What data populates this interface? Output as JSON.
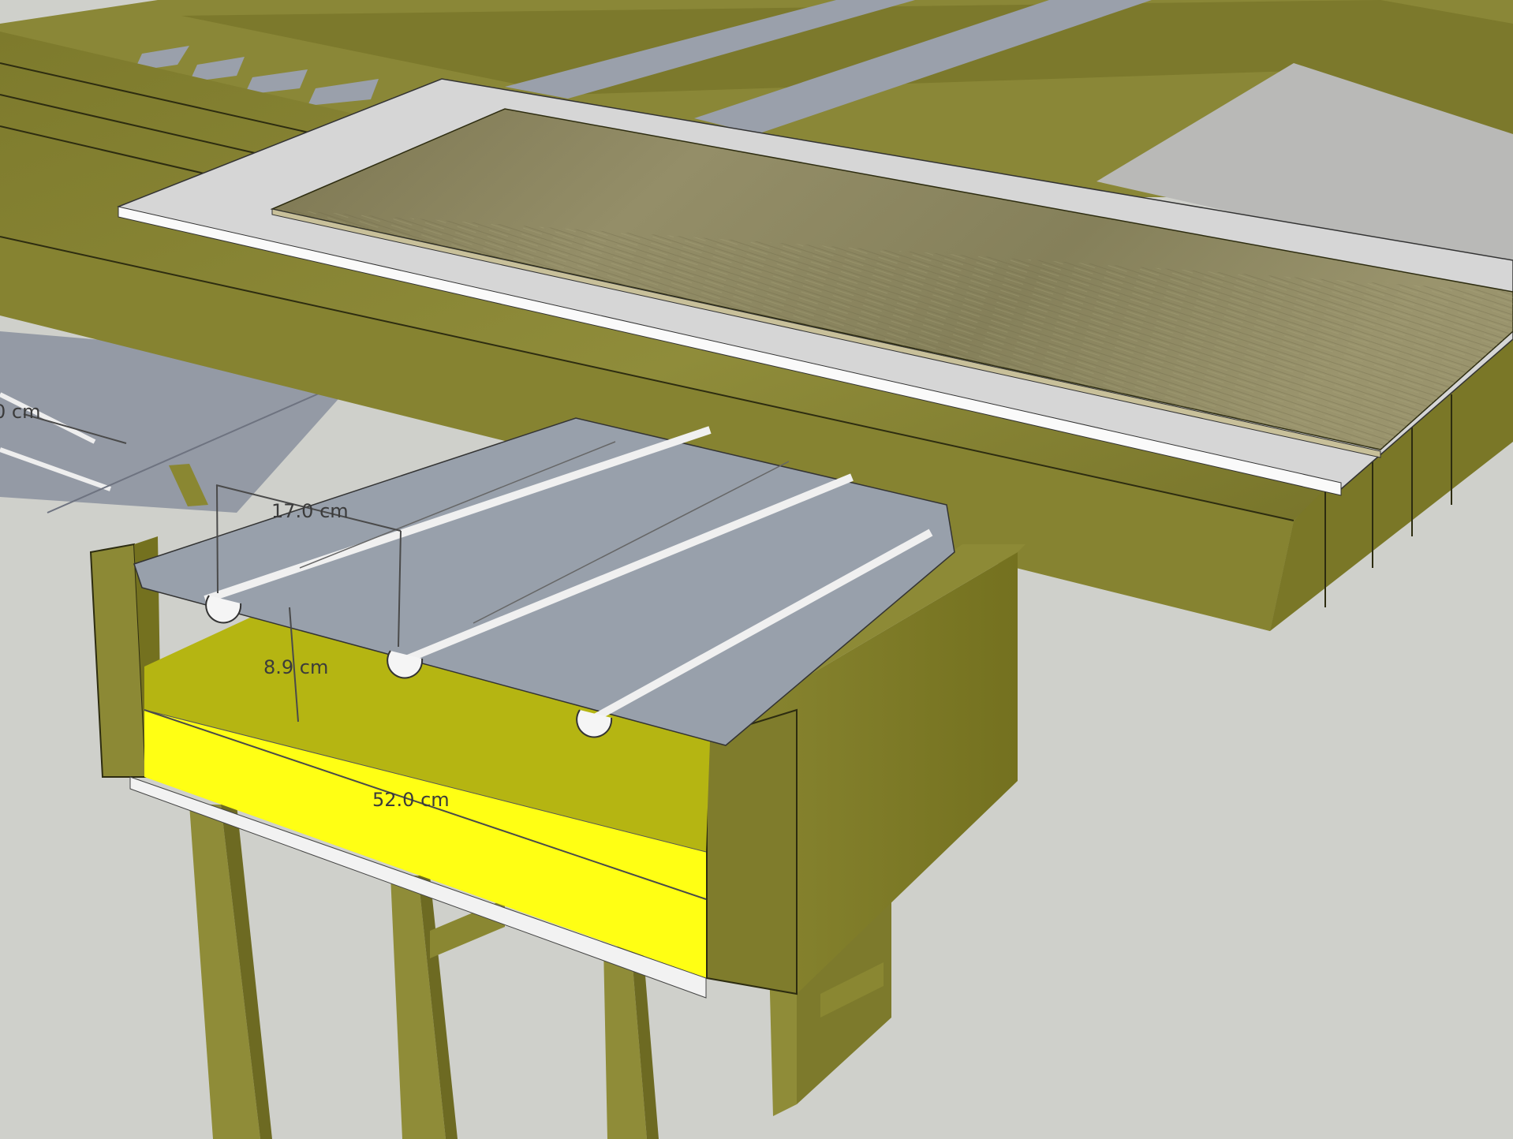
{
  "dimensions": {
    "partial": "0 cm",
    "spacing": "17.0 cm",
    "depth": "8.9 cm",
    "width": "52.0 cm"
  },
  "colors": {
    "background": "#cfd0cb",
    "wood_light": "#8c8a3a",
    "wood_dark": "#6d6b26",
    "insulation_top": "#b5b512",
    "insulation_bottom": "#ffff12",
    "metal_plate": "#949aa6",
    "board_white": "#d9d9d9",
    "flooring": "#8a8660"
  }
}
